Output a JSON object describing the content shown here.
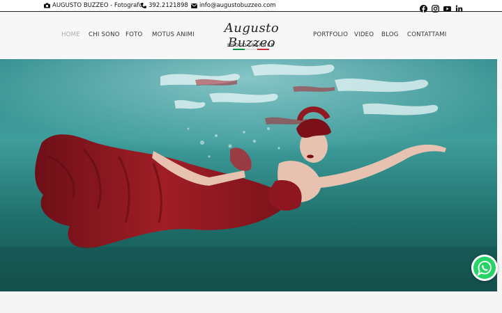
{
  "topbar": {
    "brand": "AUGUSTO BUZZEO - Fotografo",
    "phone": "392.2121898",
    "email": "info@augustobuzzeo.com",
    "social": [
      "facebook-icon",
      "instagram-icon",
      "youtube-icon",
      "linkedin-icon"
    ]
  },
  "nav": {
    "left": [
      "HOME",
      "CHI SONO",
      "FOTO",
      "MOTUS ANIMI"
    ],
    "right": [
      "PORTFOLIO",
      "VIDEO",
      "BLOG",
      "CONTATTAMI"
    ],
    "active": "HOME"
  },
  "logo": {
    "script": "Augusto Buzzeo",
    "subtitle": "PHOTOGRAPHER",
    "flag_colors": [
      "#009246",
      "#ffffff",
      "#ce2b37"
    ]
  },
  "hero": {
    "description": "Underwater photo of a woman in a red dress"
  },
  "colors": {
    "whatsapp": "#25d366",
    "water": "#1f6c68",
    "dress": "#8e1620"
  }
}
